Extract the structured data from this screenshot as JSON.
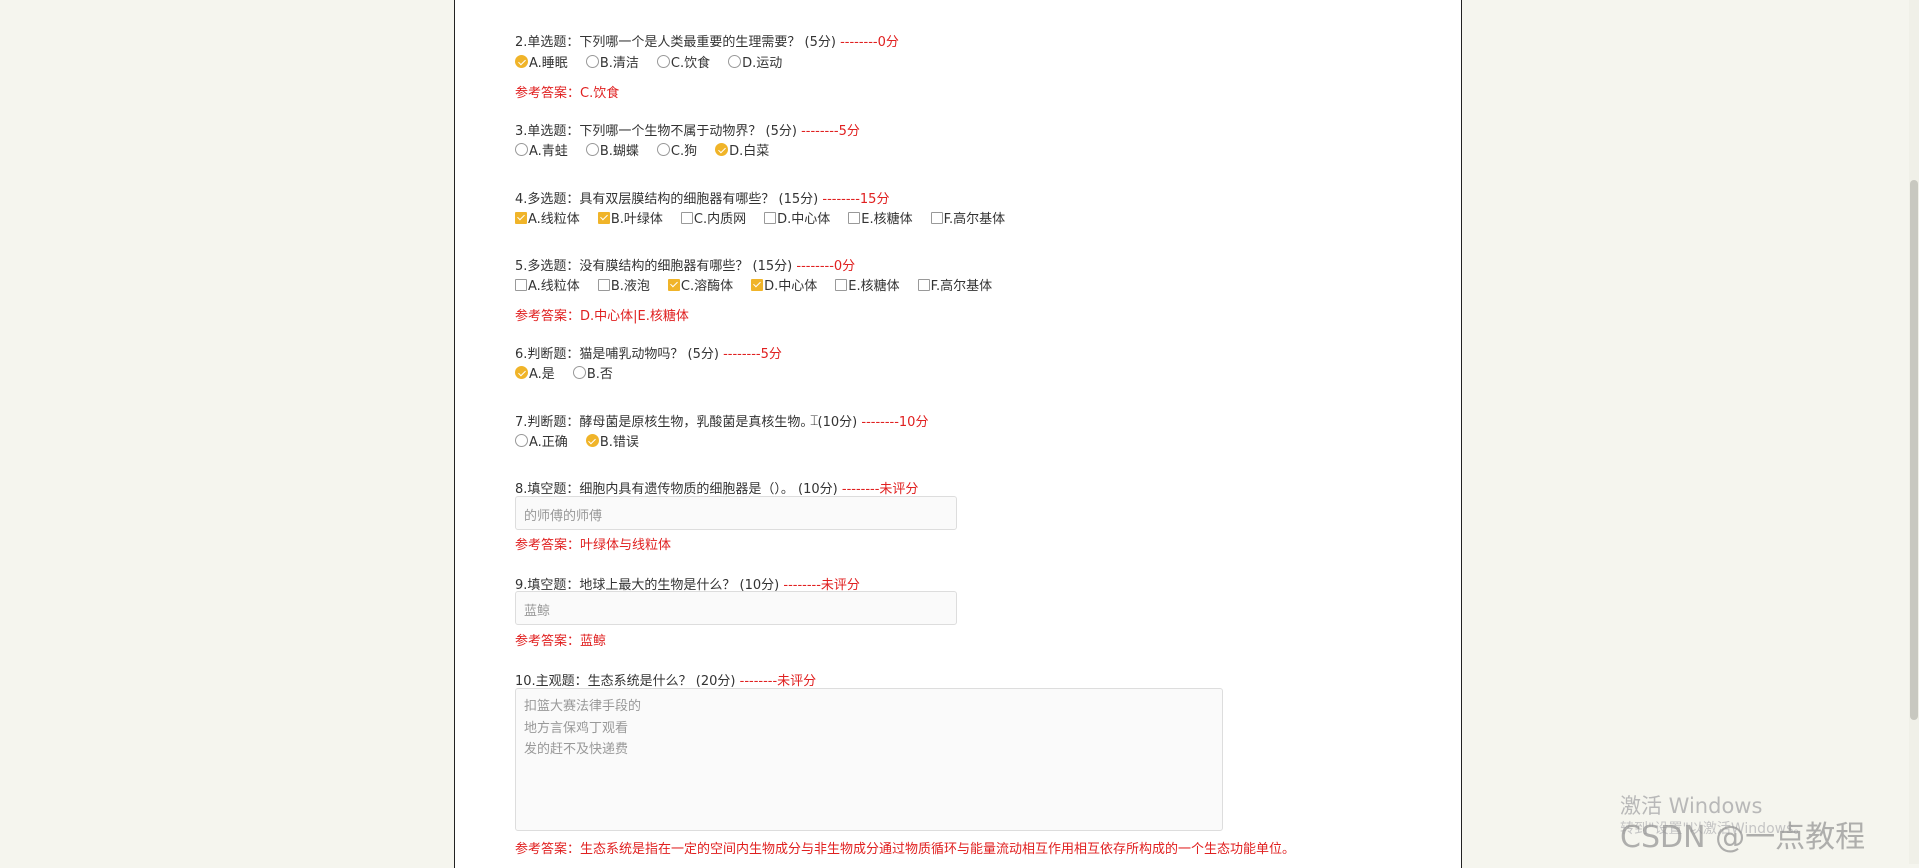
{
  "questions": [
    {
      "title": "2.单选题：下列哪一个是人类最重要的生理需要？ (5分)",
      "score": "--------0分",
      "type": "radio",
      "options": [
        {
          "label": "A.睡眠",
          "checked": true
        },
        {
          "label": "B.清洁",
          "checked": false
        },
        {
          "label": "C.饮食",
          "checked": false
        },
        {
          "label": "D.运动",
          "checked": false
        }
      ],
      "answer": "参考答案：C.饮食"
    },
    {
      "title": "3.单选题：下列哪一个生物不属于动物界？ (5分)",
      "score": "--------5分",
      "type": "radio",
      "options": [
        {
          "label": "A.青蛙",
          "checked": false
        },
        {
          "label": "B.蝴蝶",
          "checked": false
        },
        {
          "label": "C.狗",
          "checked": false
        },
        {
          "label": "D.白菜",
          "checked": true
        }
      ]
    },
    {
      "title": "4.多选题：具有双层膜结构的细胞器有哪些？ (15分)",
      "score": "--------15分",
      "type": "check",
      "options": [
        {
          "label": "A.线粒体",
          "checked": true
        },
        {
          "label": "B.叶绿体",
          "checked": true
        },
        {
          "label": "C.内质网",
          "checked": false
        },
        {
          "label": "D.中心体",
          "checked": false
        },
        {
          "label": "E.核糖体",
          "checked": false
        },
        {
          "label": "F.高尔基体",
          "checked": false
        }
      ]
    },
    {
      "title": "5.多选题：没有膜结构的细胞器有哪些？ (15分)",
      "score": "--------0分",
      "type": "check",
      "options": [
        {
          "label": "A.线粒体",
          "checked": false
        },
        {
          "label": "B.液泡",
          "checked": false
        },
        {
          "label": "C.溶酶体",
          "checked": true
        },
        {
          "label": "D.中心体",
          "checked": true
        },
        {
          "label": "E.核糖体",
          "checked": false
        },
        {
          "label": "F.高尔基体",
          "checked": false
        }
      ],
      "answer": "参考答案：D.中心体|E.核糖体"
    },
    {
      "title": "6.判断题：猫是哺乳动物吗？ (5分)",
      "score": "--------5分",
      "type": "radio",
      "options": [
        {
          "label": "A.是",
          "checked": true
        },
        {
          "label": "B.否",
          "checked": false
        }
      ]
    },
    {
      "title": "7.判断题：酵母菌是原核生物，乳酸菌是真核生物。 (10分)",
      "score": "--------10分",
      "type": "radio",
      "options": [
        {
          "label": "A.正确",
          "checked": false
        },
        {
          "label": "B.错误",
          "checked": true
        }
      ]
    },
    {
      "title": "8.填空题：细胞内具有遗传物质的细胞器是（）。 (10分)",
      "score": "--------未评分",
      "type": "fill",
      "value": "的师傅的师傅",
      "answer": "参考答案：叶绿体与线粒体"
    },
    {
      "title": "9.填空题：地球上最大的生物是什么？ (10分)",
      "score": "--------未评分",
      "type": "fill",
      "value": "蓝鲸",
      "answer": "参考答案：蓝鲸"
    },
    {
      "title": "10.主观题：生态系统是什么？ (20分)",
      "score": "--------未评分",
      "type": "text",
      "lines": [
        "扣篮大赛法律手段的",
        "地方言保鸡丁观看",
        "发的赶不及快递费"
      ],
      "answer": "参考答案：生态系统是指在一定的空间内生物成分与非生物成分通过物质循环与能量流动相互作用相互依存所构成的一个生态功能单位。"
    }
  ],
  "watermark": {
    "activate": "激活 Windows",
    "goto": "转到\"设置\"以激活Windows。",
    "csdn": "CSDN @一点教程"
  },
  "colors": {
    "accent": "#f0b429",
    "score": "#e02020",
    "background": "#f5f5ee"
  }
}
